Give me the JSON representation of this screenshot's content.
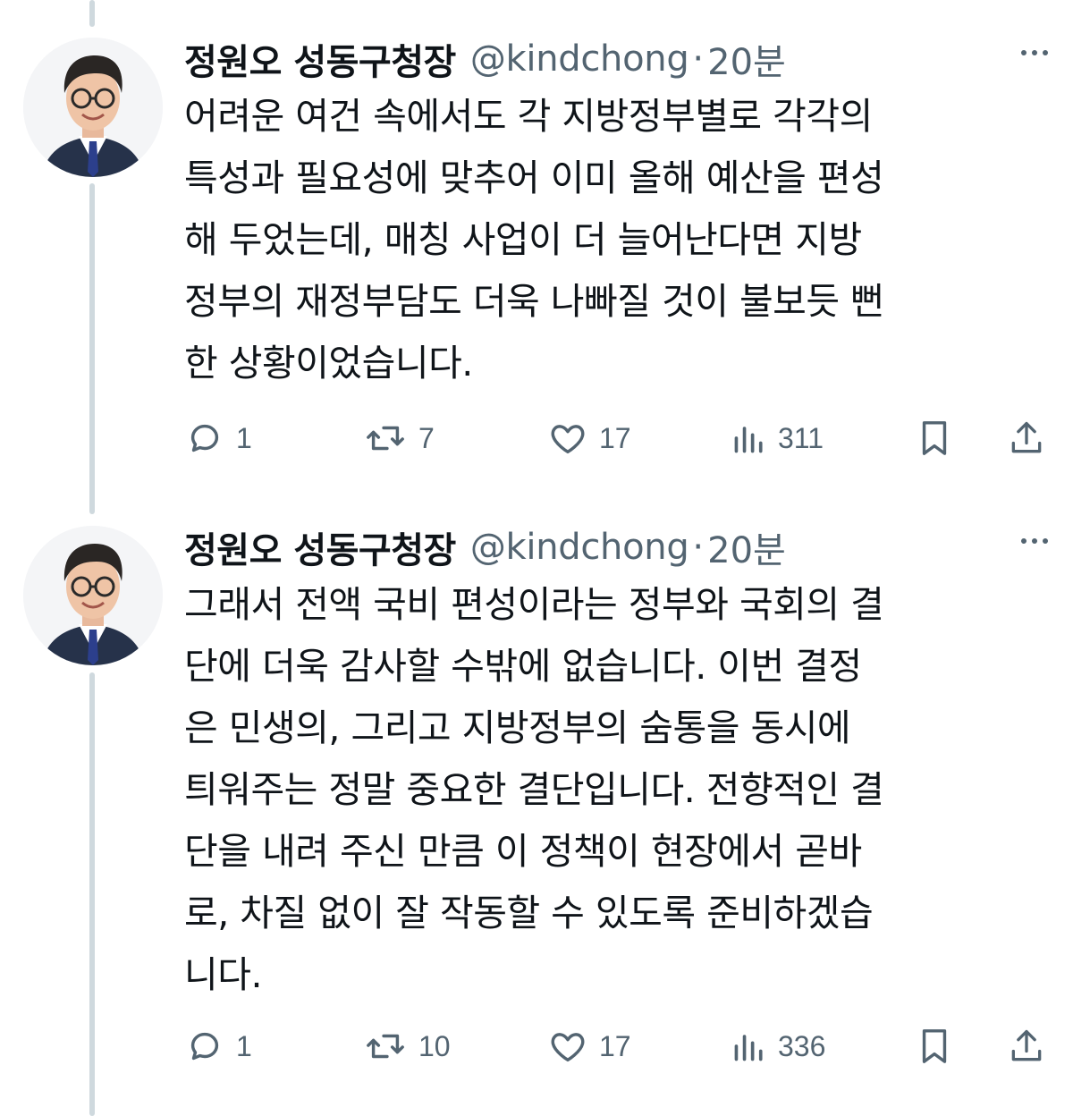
{
  "tweets": [
    {
      "name": "정원오 성동구청장",
      "handle": "@kindchong",
      "separator": "·",
      "time": "20분",
      "lines": [
        "어려운 여건 속에서도 각 지방정부별로 각각의",
        "특성과 필요성에 맞추어 이미 올해 예산을 편성",
        "해 두었는데, 매칭 사업이 더 늘어난다면 지방",
        "정부의 재정부담도 더욱 나빠질 것이 불보듯 뻔",
        "한 상황이었습니다."
      ],
      "actions": {
        "replies": "1",
        "reposts": "7",
        "likes": "17",
        "views": "311"
      }
    },
    {
      "name": "정원오 성동구청장",
      "handle": "@kindchong",
      "separator": "·",
      "time": "20분",
      "lines": [
        "그래서 전액 국비 편성이라는 정부와 국회의 결",
        "단에 더욱 감사할 수밖에 없습니다. 이번 결정",
        "은 민생의, 그리고 지방정부의 숨통을 동시에",
        "틔워주는 정말 중요한 결단입니다. 전향적인 결",
        "단을 내려 주신 만큼 이 정책이 현장에서 곧바",
        "로, 차질 없이 잘 작동할 수 있도록 준비하겠습",
        "니다."
      ],
      "actions": {
        "replies": "1",
        "reposts": "10",
        "likes": "17",
        "views": "336"
      }
    }
  ],
  "colors": {
    "text": "#0f1419",
    "secondary": "#536471",
    "thread_line": "#cfd9de"
  },
  "icons": [
    "reply-icon",
    "repost-icon",
    "like-icon",
    "views-icon",
    "bookmark-icon",
    "share-icon",
    "more-icon"
  ]
}
